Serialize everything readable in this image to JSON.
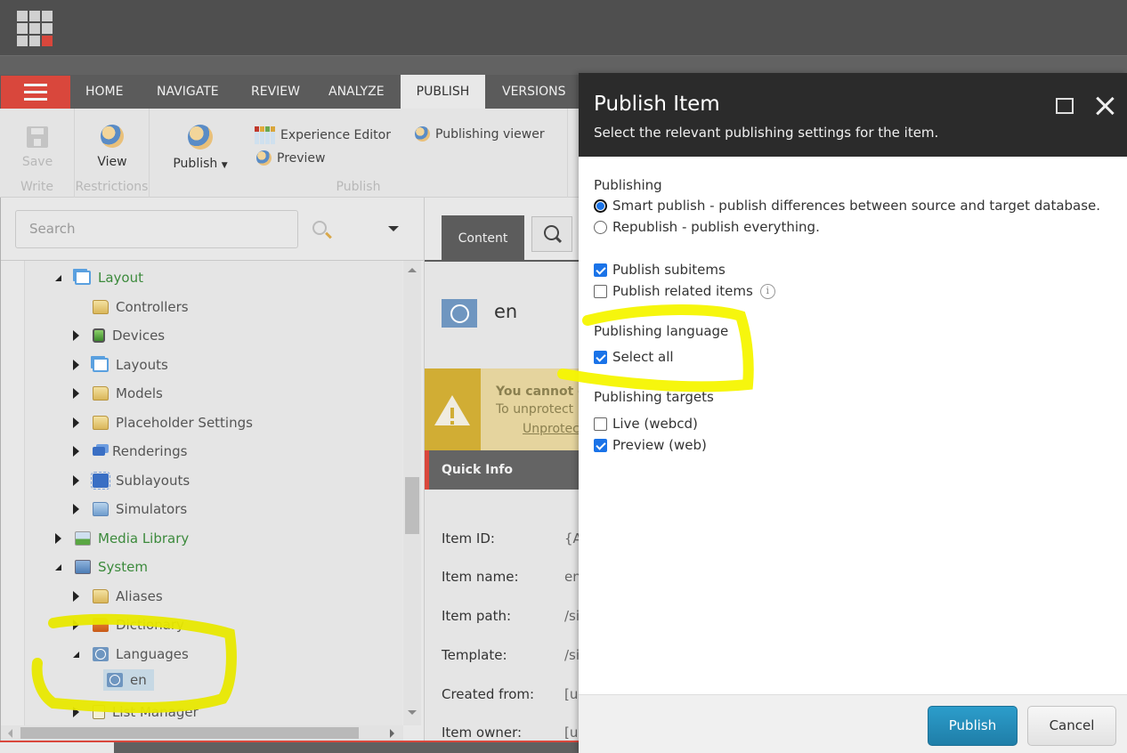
{
  "app": {
    "tabs": [
      {
        "label": "HOME",
        "active": false
      },
      {
        "label": "NAVIGATE",
        "active": false
      },
      {
        "label": "REVIEW",
        "active": false
      },
      {
        "label": "ANALYZE",
        "active": false
      },
      {
        "label": "PUBLISH",
        "active": true
      },
      {
        "label": "VERSIONS",
        "active": false
      }
    ],
    "accent_color": "#d9473c"
  },
  "ribbon": {
    "write": {
      "group_label": "Write",
      "save_label": "Save"
    },
    "restrictions": {
      "group_label": "Restrictions",
      "view_label": "View"
    },
    "publish": {
      "group_label": "Publish",
      "publish_label": "Publish",
      "experience_editor_label": "Experience Editor",
      "preview_label": "Preview",
      "publishing_viewer_label": "Publishing viewer"
    }
  },
  "tree": {
    "search_placeholder": "Search",
    "nodes": [
      {
        "label": "Layout",
        "icon": "layout-icon",
        "state": "open",
        "green": true
      },
      {
        "label": "Controllers",
        "icon": "folder-icon",
        "state": "none",
        "green": false
      },
      {
        "label": "Devices",
        "icon": "device-icon",
        "state": "closed",
        "green": false
      },
      {
        "label": "Layouts",
        "icon": "layout-icon",
        "state": "closed",
        "green": false
      },
      {
        "label": "Models",
        "icon": "folder-icon",
        "state": "closed",
        "green": false
      },
      {
        "label": "Placeholder Settings",
        "icon": "folder-icon",
        "state": "closed",
        "green": false
      },
      {
        "label": "Renderings",
        "icon": "rendering-icon",
        "state": "closed",
        "green": false
      },
      {
        "label": "Sublayouts",
        "icon": "sublayout-icon",
        "state": "closed",
        "green": false
      },
      {
        "label": "Simulators",
        "icon": "blue-folder-icon",
        "state": "closed",
        "green": false
      },
      {
        "label": "Media Library",
        "icon": "media-icon",
        "state": "closed",
        "green": true
      },
      {
        "label": "System",
        "icon": "system-icon",
        "state": "open",
        "green": true
      },
      {
        "label": "Aliases",
        "icon": "folder-icon",
        "state": "closed",
        "green": false
      },
      {
        "label": "Dictionary",
        "icon": "dictionary-icon",
        "state": "closed",
        "green": false
      },
      {
        "label": "Languages",
        "icon": "language-icon",
        "state": "open",
        "green": false
      },
      {
        "label": "en",
        "icon": "language-icon",
        "state": "none",
        "green": false,
        "selected": true
      },
      {
        "label": "List Manager",
        "icon": "list-icon",
        "state": "closed",
        "green": false
      }
    ]
  },
  "content": {
    "tab_label": "Content",
    "item_name": "en",
    "warning": {
      "line1": "You cannot e",
      "line2": "To unprotect",
      "link": "Unprotec"
    },
    "quick_info_label": "Quick Info",
    "info": [
      {
        "key": "Item ID:",
        "value": "{A"
      },
      {
        "key": "Item name:",
        "value": "en"
      },
      {
        "key": "Item path:",
        "value": "/si"
      },
      {
        "key": "Template:",
        "value": "/si"
      },
      {
        "key": "Created from:",
        "value": "[u"
      },
      {
        "key": "Item owner:",
        "value": "[u"
      }
    ]
  },
  "modal": {
    "title": "Publish Item",
    "subtitle": "Select the relevant publishing settings for the item.",
    "publishing_label": "Publishing",
    "smart_publish_label": "Smart publish - publish differences between source and target database.",
    "smart_publish_selected": true,
    "republish_label": "Republish - publish everything.",
    "republish_selected": false,
    "subitems_label": "Publish subitems",
    "subitems_checked": true,
    "related_label": "Publish related items",
    "related_checked": false,
    "language_section_label": "Publishing language",
    "select_all_label": "Select all",
    "select_all_checked": true,
    "targets_section_label": "Publishing targets",
    "targets": [
      {
        "label": "Live (webcd)",
        "checked": false
      },
      {
        "label": "Preview (web)",
        "checked": true
      }
    ],
    "publish_button": "Publish",
    "cancel_button": "Cancel",
    "publish_button_color": "#2589b6"
  }
}
